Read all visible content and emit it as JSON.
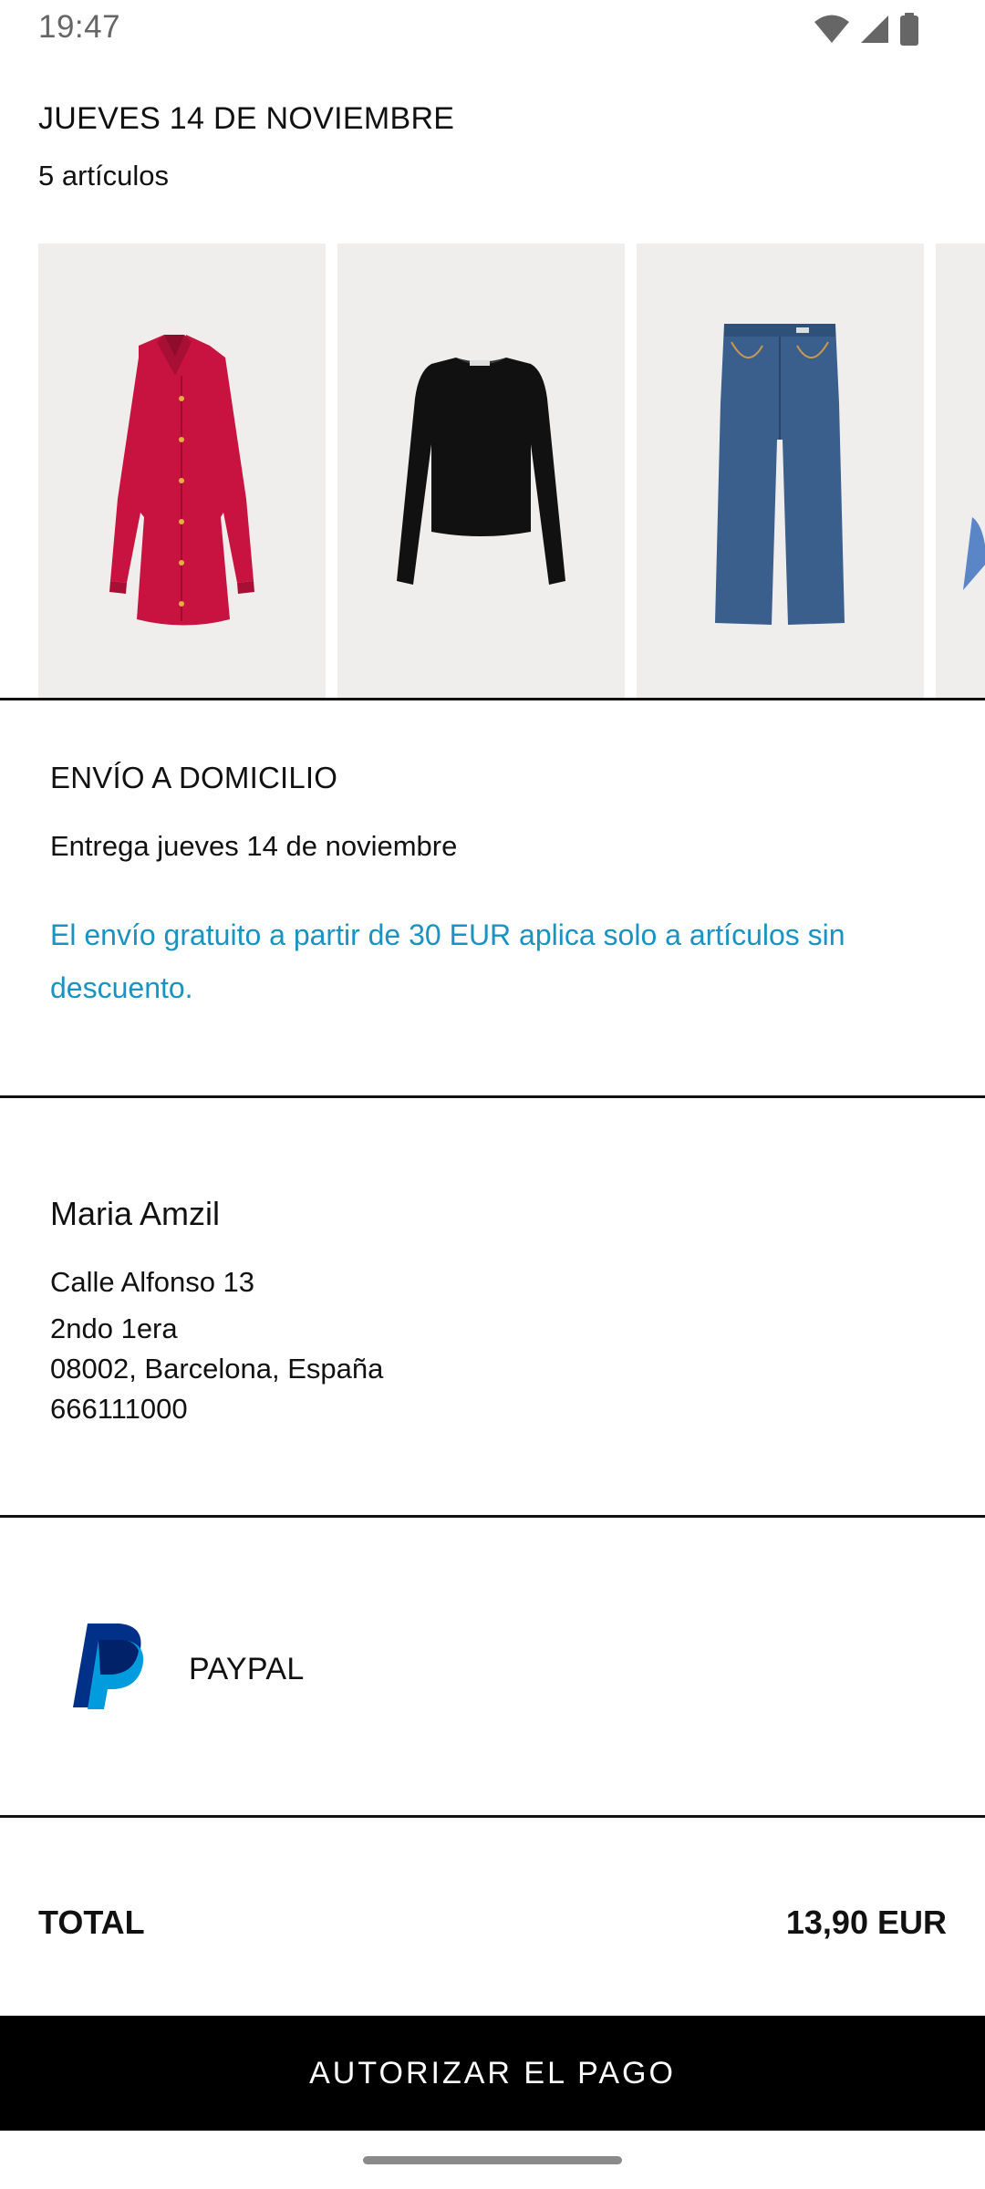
{
  "status_bar": {
    "time": "19:47",
    "icons": [
      "wifi-icon",
      "signal-icon",
      "battery-icon"
    ]
  },
  "order": {
    "date": "JUEVES 14 DE NOVIEMBRE",
    "item_count": "5 artículos",
    "products": [
      {
        "name": "red-silk-shirt",
        "color": "#c8123f"
      },
      {
        "name": "black-long-sleeve-top",
        "color": "#111111"
      },
      {
        "name": "blue-straight-jeans",
        "color": "#3a5f8c"
      },
      {
        "name": "blue-striped-item",
        "color": "#5a86c8"
      }
    ]
  },
  "shipping": {
    "title": "ENVÍO A DOMICILIO",
    "delivery": "Entrega jueves 14 de noviembre",
    "note": "El envío gratuito a partir de 30 EUR aplica solo a artículos sin descuento.",
    "note_color": "#1a93c2"
  },
  "address": {
    "name": "Maria Amzil",
    "street": "Calle Alfonso 13",
    "floor": "2ndo 1era",
    "city": "08002, Barcelona, España",
    "phone": "666111000"
  },
  "payment": {
    "method": "PAYPAL",
    "icon": "paypal-icon"
  },
  "total": {
    "label": "TOTAL",
    "amount": "13,90 EUR"
  },
  "cta": {
    "label": "AUTORIZAR EL PAGO"
  }
}
